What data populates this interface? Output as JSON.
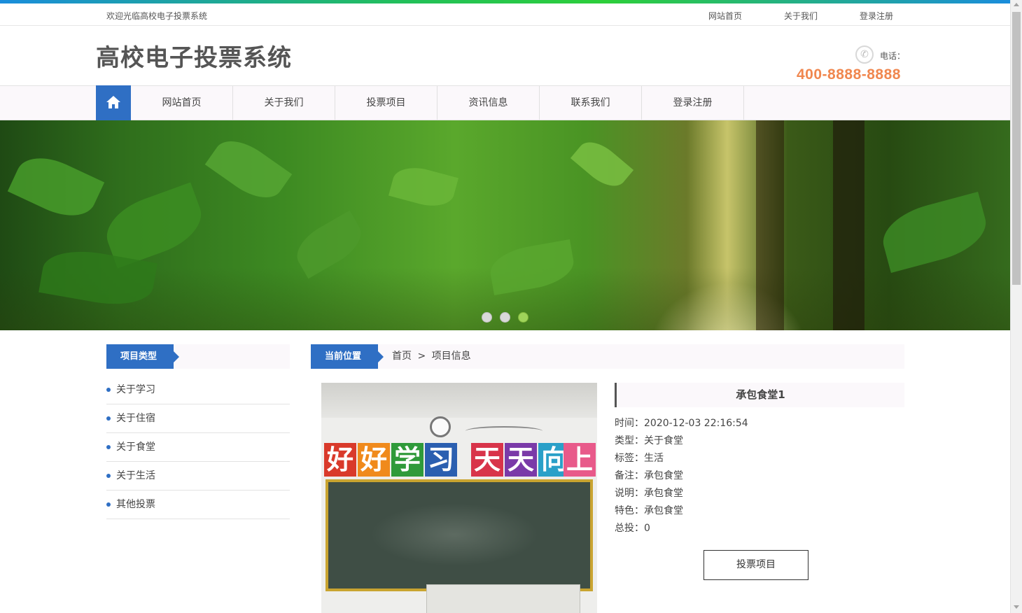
{
  "topbar": {
    "welcome": "欢迎光临高校电子投票系统",
    "links": [
      "网站首页",
      "关于我们",
      "登录注册"
    ]
  },
  "header": {
    "site_title": "高校电子投票系统",
    "phone_label": "电话：",
    "phone_number": "400-8888-8888",
    "phone_icon": "phone-icon"
  },
  "nav": {
    "home_icon": "home-icon",
    "items": [
      "网站首页",
      "关于我们",
      "投票项目",
      "资讯信息",
      "联系我们",
      "登录注册"
    ]
  },
  "banner": {
    "slide_count": 3,
    "active_slide": 3
  },
  "sidebar": {
    "heading": "项目类型",
    "items": [
      "关于学习",
      "关于住宿",
      "关于食堂",
      "关于生活",
      "其他投票"
    ]
  },
  "breadcrumb": {
    "label": "当前位置",
    "home": "首页",
    "separator": ">",
    "current": "项目信息"
  },
  "photo": {
    "banner_chars": [
      "好",
      "好",
      "学",
      "习",
      "天",
      "天",
      "向",
      "上"
    ]
  },
  "detail": {
    "title": "承包食堂1",
    "rows": [
      "时间：2020-12-03 22:16:54",
      "类型：关于食堂",
      "标签：生活",
      "备注：承包食堂",
      "说明：承包食堂",
      "特色：承包食堂",
      "总投：0"
    ],
    "vote_button": "投票项目"
  },
  "colors": {
    "accent": "#2f6fc4",
    "phone": "#f0874f",
    "nav_bg": "#fbf8fb"
  }
}
